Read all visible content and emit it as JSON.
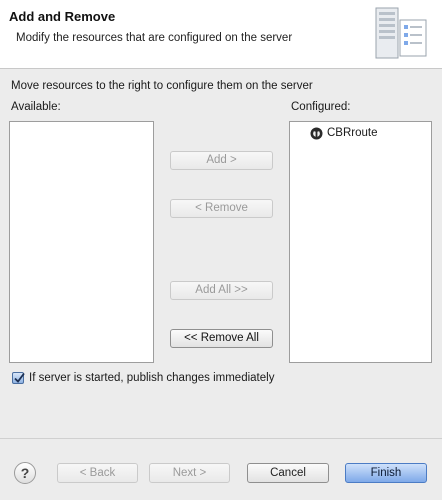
{
  "banner": {
    "title": "Add and Remove",
    "description": "Modify the resources that are configured on the server",
    "graphic_icon": "server-icon"
  },
  "instruction": "Move resources to the right to configure them on the server",
  "available": {
    "label": "Available:",
    "items": []
  },
  "configured": {
    "label": "Configured:",
    "items": [
      {
        "label": "CBRroute",
        "icon": "module-icon"
      }
    ]
  },
  "buttons": {
    "add": "Add >",
    "remove": "< Remove",
    "add_all": "Add All >>",
    "remove_all": "<< Remove All"
  },
  "publish_checkbox": {
    "label": "If server is started, publish changes immediately",
    "checked": true
  },
  "footer": {
    "help": "?",
    "back": "< Back",
    "next": "Next >",
    "cancel": "Cancel",
    "finish": "Finish"
  },
  "colors": {
    "accent": "#7fa9e9",
    "disabled_text": "#9a9a9a"
  }
}
